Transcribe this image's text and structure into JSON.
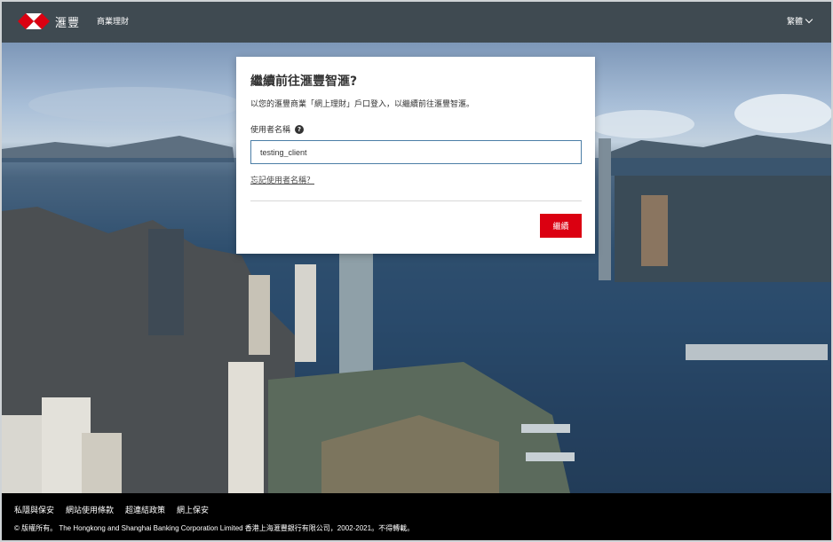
{
  "header": {
    "brand": "滙豐",
    "nav_link": "商業理財",
    "language": "繁體",
    "colors": {
      "bar": "#3f4a51",
      "logo_red": "#db0011"
    }
  },
  "card": {
    "title": "繼續前往滙豐智滙?",
    "description": "以您的滙豐商業「網上理財」戶口登入，以繼續前往滙豐智滙。",
    "username_label": "使用者名稱",
    "help_icon_glyph": "?",
    "username_value": "testing_client",
    "forgot_link": "忘記使用者名稱？",
    "continue_button": "繼續",
    "colors": {
      "input_border": "#4c7ea6",
      "button": "#db0011"
    }
  },
  "footer": {
    "links": [
      "私隱與保安",
      "網站使用條款",
      "超連結政策",
      "網上保安"
    ],
    "copyright": "© 版權所有。 The Hongkong and Shanghai Banking Corporation Limited 香港上海滙豐銀行有限公司，2002-2021。不得轉載。"
  },
  "icons": [
    "hsbc-logo-icon",
    "chevron-down-icon",
    "help-icon"
  ]
}
